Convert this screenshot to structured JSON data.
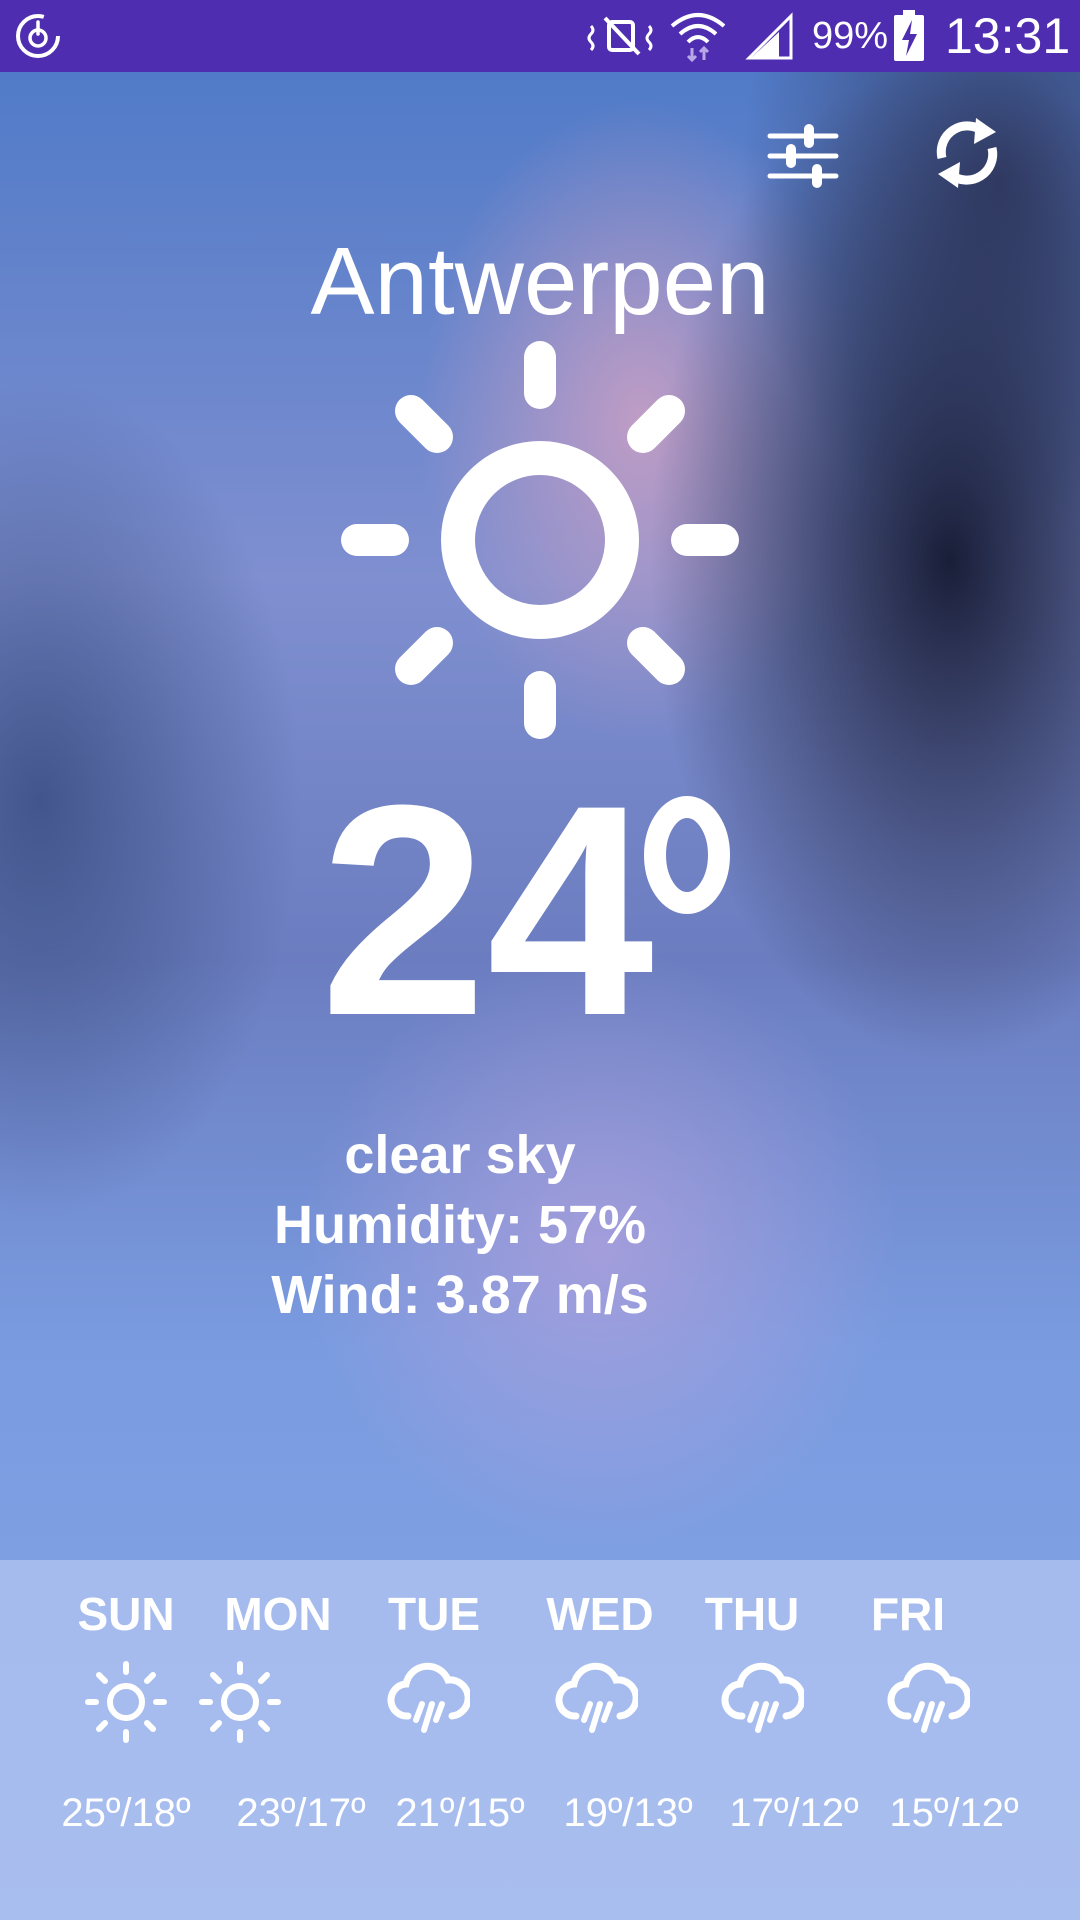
{
  "status_bar": {
    "battery_percent": "99%",
    "time": "13:31",
    "icons": [
      "app-power-icon",
      "mute-icon",
      "wifi-icon",
      "signal-icon",
      "battery-charging-icon"
    ]
  },
  "toolbar": {
    "icons": [
      "settings-sliders-icon",
      "refresh-icon"
    ]
  },
  "current": {
    "city": "Antwerpen",
    "condition_icon": "sun-icon",
    "temperature": "24",
    "description": "clear sky",
    "humidity": "Humidity: 57%",
    "wind": "Wind: 3.87 m/s"
  },
  "forecast": [
    {
      "day": "SUN",
      "icon": "sun-icon",
      "temps": "25º/18º"
    },
    {
      "day": "MON",
      "icon": "sun-icon",
      "temps": "23º/17º"
    },
    {
      "day": "TUE",
      "icon": "rain-cloud-icon",
      "temps": "21º/15º"
    },
    {
      "day": "WED",
      "icon": "rain-cloud-icon",
      "temps": "19º/13º"
    },
    {
      "day": "THU",
      "icon": "rain-cloud-icon",
      "temps": "17º/12º"
    },
    {
      "day": "FRI",
      "icon": "rain-cloud-icon",
      "temps": "15º/12º"
    }
  ]
}
